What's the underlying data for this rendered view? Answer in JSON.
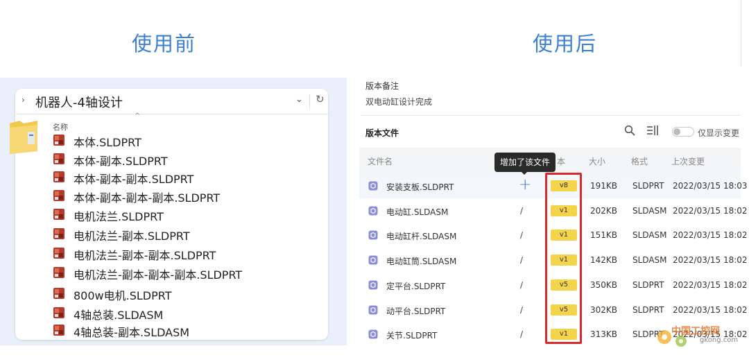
{
  "headings": {
    "before": "使用前",
    "after": "使用后"
  },
  "explorer": {
    "address": "机器人-4轴设计",
    "column_name": "名称",
    "files": [
      "本体.SLDPRT",
      "本体-副本.SLDPRT",
      "本体-副本-副本.SLDPRT",
      "本体-副本-副本-副本.SLDPRT",
      "电机法兰.SLDPRT",
      "电机法兰-副本.SLDPRT",
      "电机法兰-副本-副本.SLDPRT",
      "电机法兰-副本-副本-副本.SLDPRT",
      "800w电机.SLDPRT",
      "4轴总装.SLDASM",
      "4轴总装-副本.SLDASM"
    ]
  },
  "versions": {
    "note_label": "版本备注",
    "note_text": "双电动缸设计完成",
    "files_title": "版本文件",
    "toggle_label": "仅显示变更",
    "columns": {
      "name": "文件名",
      "version": "本",
      "size": "大小",
      "format": "格式",
      "modified": "上次变更"
    },
    "tooltip": "增加了该文件",
    "rows": [
      {
        "name": "安装支板.SLDPRT",
        "change": "+",
        "version": "v8",
        "size": "191KB",
        "format": "SLDPRT",
        "modified": "2022/03/15 18:03"
      },
      {
        "name": "电动缸.SLDASM",
        "change": "/",
        "version": "v1",
        "size": "202KB",
        "format": "SLDASM",
        "modified": "2022/03/15 18:02"
      },
      {
        "name": "电动缸杆.SLDASM",
        "change": "/",
        "version": "v1",
        "size": "151KB",
        "format": "SLDASM",
        "modified": "2022/03/15 18:02"
      },
      {
        "name": "电动缸筒.SLDASM",
        "change": "/",
        "version": "v1",
        "size": "142KB",
        "format": "SLDASM",
        "modified": "2022/03/15 18:02"
      },
      {
        "name": "定平台.SLDPRT",
        "change": "/",
        "version": "v5",
        "size": "350KB",
        "format": "SLDPRT",
        "modified": "2022/03/15 18:02"
      },
      {
        "name": "动平台.SLDPRT",
        "change": "/",
        "version": "v5",
        "size": "302KB",
        "format": "SLDPRT",
        "modified": "2022/03/15 18:02"
      },
      {
        "name": "关节.SLDPRT",
        "change": "/",
        "version": "v1",
        "size": "313KB",
        "format": "SLDPRT",
        "modified": "2022/03/15 18:02"
      }
    ]
  },
  "watermark": {
    "name": "中国工控网",
    "url": "gkong.com"
  },
  "colors": {
    "heading": "#3a7fd6",
    "version_badge": "#f4d44a",
    "highlight_box": "#d72a2a",
    "plus": "#4a7bd6"
  }
}
